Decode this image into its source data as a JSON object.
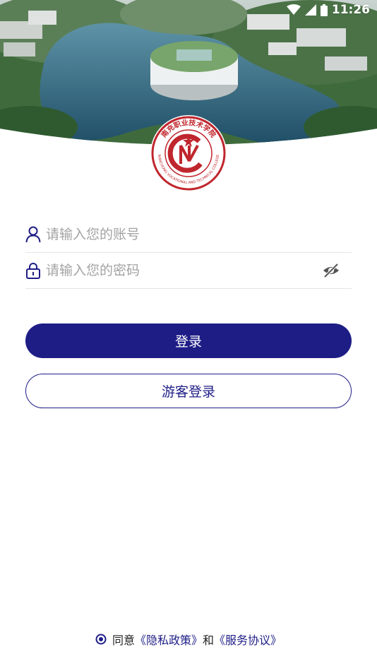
{
  "status_bar": {
    "time": "11:26",
    "icons": [
      "wifi-icon",
      "cellular-signal-icon",
      "battery-icon"
    ]
  },
  "header": {
    "image": "campus-aerial-photo",
    "logo": {
      "icon": "college-emblem-logo",
      "text_cn": "南充职业技术学院",
      "text_en": "NANCHONG VOCATIONAL AND TECHNICAL COLLEGE",
      "monogram": "NV"
    }
  },
  "login_form": {
    "account": {
      "icon": "user-icon",
      "value": "",
      "placeholder": "请输入您的账号"
    },
    "password": {
      "icon": "lock-icon",
      "value": "",
      "placeholder": "请输入您的密码",
      "toggle_icon": "eye-hidden-icon"
    },
    "login_label": "登录",
    "guest_label": "游客登录"
  },
  "agreement": {
    "prefix": "同意",
    "privacy_link": "《隐私政策》",
    "and": "和",
    "service_link": "《服务协议》",
    "radio_icon": "radio-checked-icon"
  },
  "colors": {
    "primary": "#1e1d86",
    "logo_red": "#c0262d",
    "placeholder": "#a3a3a3"
  }
}
